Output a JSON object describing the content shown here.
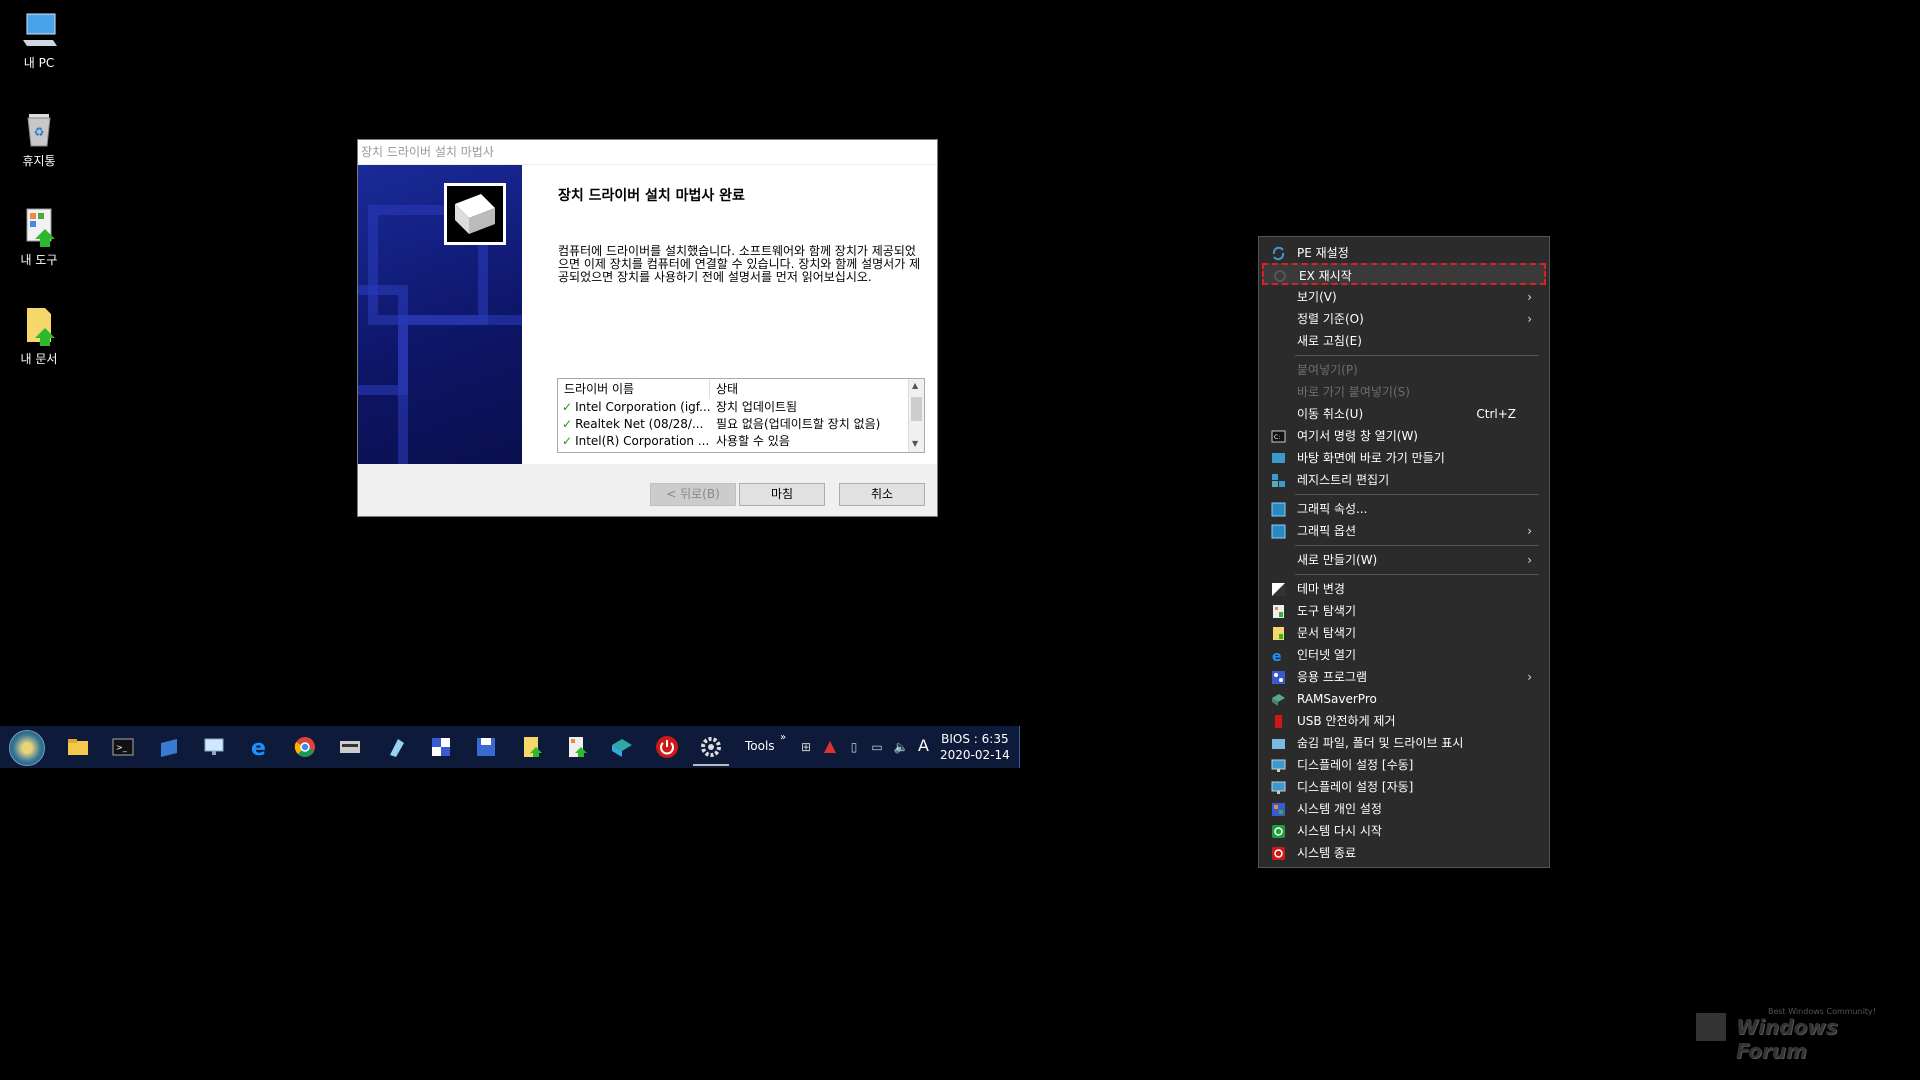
{
  "desktop": {
    "icons": [
      {
        "label": "내 PC"
      },
      {
        "label": "휴지통"
      },
      {
        "label": "내 도구"
      },
      {
        "label": "내 문서"
      }
    ]
  },
  "dialog": {
    "title": "장치 드라이버 설치 마법사",
    "heading": "장치 드라이버 설치 마법사 완료",
    "description": "컴퓨터에 드라이버를 설치했습니다. 소프트웨어와 함께 장치가 제공되었으면 이제 장치를 컴퓨터에 연결할 수 있습니다. 장치와 함께 설명서가 제공되었으면 장치를 사용하기 전에 설명서를 먼저 읽어보십시오.",
    "table": {
      "col_name": "드라이버 이름",
      "col_status": "상태",
      "rows": [
        {
          "name": "Intel Corporation (igf...",
          "status": "장치 업데이트됨"
        },
        {
          "name": "Realtek Net  (08/28/...",
          "status": "필요 없음(업데이트할 장치 없음)"
        },
        {
          "name": "Intel(R) Corporation ...",
          "status": "사용할 수 있음"
        }
      ]
    },
    "buttons": {
      "back": "< 뒤로(B)",
      "finish": "마침",
      "cancel": "취소"
    }
  },
  "taskbar": {
    "tools_label": "Tools",
    "overflow": "»",
    "ime": "A",
    "clock_line1": "BIOS : 6:35",
    "clock_line2": "2020-02-14"
  },
  "context_menu": {
    "items": [
      {
        "label": "PE 재설정"
      },
      {
        "label": "EX 재시작"
      },
      {
        "label": "보기(V)"
      },
      {
        "label": "정렬 기준(O)"
      },
      {
        "label": "새로 고침(E)"
      },
      {
        "label": "붙여넣기(P)"
      },
      {
        "label": "바로 가기 붙여넣기(S)"
      },
      {
        "label": "이동 취소(U)",
        "shortcut": "Ctrl+Z"
      },
      {
        "label": "여기서 명령 창 열기(W)"
      },
      {
        "label": "바탕 화면에 바로 가기 만들기"
      },
      {
        "label": "레지스트리 편집기"
      },
      {
        "label": "그래픽 속성..."
      },
      {
        "label": "그래픽 옵션"
      },
      {
        "label": "새로 만들기(W)"
      },
      {
        "label": "테마 변경"
      },
      {
        "label": "도구 탐색기"
      },
      {
        "label": "문서 탐색기"
      },
      {
        "label": "인터넷 열기"
      },
      {
        "label": "응용 프로그램"
      },
      {
        "label": "RAMSaverPro"
      },
      {
        "label": "USB 안전하게 제거"
      },
      {
        "label": "숨김 파일, 폴더 및 드라이브 표시"
      },
      {
        "label": "디스플레이 설정 [수동]"
      },
      {
        "label": "디스플레이 설정 [자동]"
      },
      {
        "label": "시스템 개인 설정"
      },
      {
        "label": "시스템 다시 시작"
      },
      {
        "label": "시스템 종료"
      }
    ]
  },
  "watermark": {
    "small": "Best Windows Community!",
    "big": "Windows Forum"
  }
}
